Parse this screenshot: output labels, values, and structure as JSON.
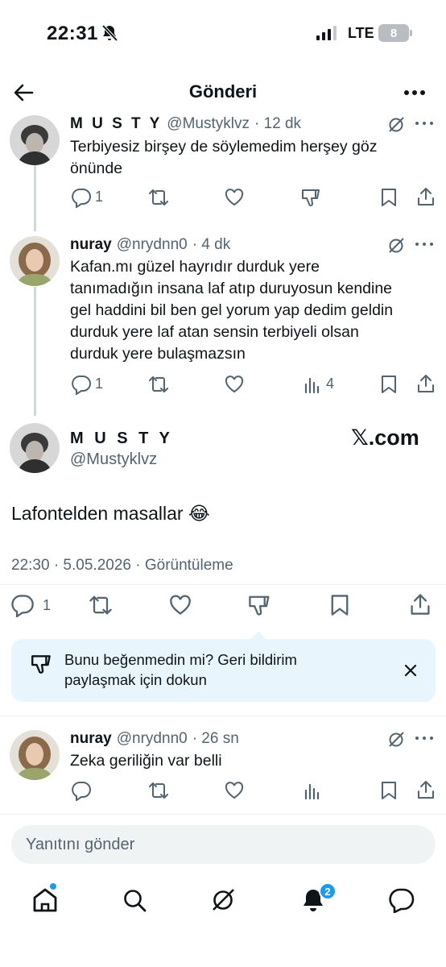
{
  "status_bar": {
    "time": "22:31",
    "network": "LTE",
    "battery": "8"
  },
  "header": {
    "title": "Gönderi"
  },
  "tweets": [
    {
      "name": "M U S T Y",
      "handle": "@Mustyklvz",
      "time": "· 12 dk",
      "lines": [
        "Terbiyesiz birşey de söylemedim herşey göz",
        "önünde"
      ],
      "replies": "1",
      "views": ""
    },
    {
      "name": "nuray",
      "handle": "@nrydnn0",
      "time": "· 4 dk",
      "lines": [
        "Kafan.mı güzel hayrıdır durduk yere",
        "tanımadığın insana laf atıp duruyosun kendine",
        "gel haddini bil ben gel yorum yap dedim geldin",
        "durduk yere  laf atan sensin terbiyeli olsan",
        "durduk yere bulaşmazsın"
      ],
      "replies": "1",
      "views": "4"
    }
  ],
  "main_tweet": {
    "name": "M U S T Y",
    "handle": "@Mustyklvz",
    "brand": "𝕏.com",
    "text": "Lafontelden masallar 😂",
    "meta": "22:30 · 5.05.2026 · Görüntüleme",
    "replies": "1"
  },
  "feedback": {
    "line1": "Bunu beğenmedin mi? Geri bildirim",
    "line2": "paylaşmak için dokun"
  },
  "reply_tweet": {
    "name": "nuray",
    "handle": "@nrydnn0",
    "time": "· 26 sn",
    "text": "Zeka geriliğin var belli"
  },
  "composer": {
    "placeholder": "Yanıtını gönder"
  },
  "bottom_nav": {
    "notifications_badge": "2"
  },
  "colors": {
    "accent": "#1d9bf0",
    "secondary_text": "#536471",
    "feedback_bg": "#e8f5fd"
  }
}
